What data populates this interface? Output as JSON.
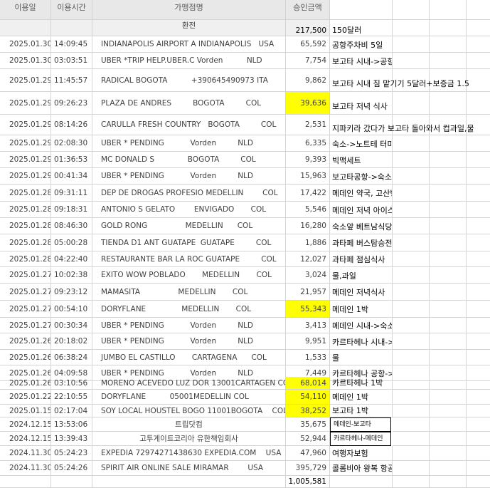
{
  "header": {
    "date": "이용일",
    "time": "이용시간",
    "merchant": "가맹점명",
    "amount": "승인금액"
  },
  "subheader": {
    "label": "환전",
    "amount": "217,500",
    "note": "150달러"
  },
  "rows": [
    {
      "date": "2025.01.30",
      "time": "14:09:45",
      "merchant": "INDIANAPOLIS AIRPORT A INDIANAPOLIS   USA",
      "amount": "65,592",
      "note": "공항주차비 5일"
    },
    {
      "date": "2025.01.30",
      "time": "03:03:51",
      "merchant": "UBER *TRIP HELP.UBER.C Vorden          NLD",
      "amount": "7,754",
      "note": "보고타 시내->공항 우버"
    },
    {
      "date": "2025.01.29",
      "time": "11:45:57",
      "merchant": "RADICAL BOGOTA          +390645490973 ITA",
      "amount": "9,862",
      "note": "보고타 시내 짐 맡기기 5달러+보증금 1.5"
    },
    {
      "date": "2025.01.29",
      "time": "09:26:23",
      "merchant": "PLAZA DE ANDRES         BOGOTA         COL",
      "amount": "39,636",
      "note": "보고타 저녁 식사"
    },
    {
      "date": "2025.01.29",
      "time": "08:14:26",
      "merchant": "CARULLA FRESH COUNTRY   BOGOTA         COL",
      "amount": "2,531",
      "note": "지파키라 갔다가 보고타 돌아와서 컵과일,물"
    },
    {
      "date": "2025.01.29",
      "time": "02:08:30",
      "merchant": "UBER * PENDING           Vorden         NLD",
      "amount": "6,335",
      "note": "숙소->노트테 터미널"
    },
    {
      "date": "2025.01.29",
      "time": "01:36:53",
      "merchant": "MC DONALD S              BOGOTA         COL",
      "amount": "9,393",
      "note": "빅맥세트"
    },
    {
      "date": "2025.01.29",
      "time": "00:41:34",
      "merchant": "UBER * PENDING           Vorden         NLD",
      "amount": "15,963",
      "note": "보고타공항->숙소 40분"
    },
    {
      "date": "2025.01.28",
      "time": "09:31:11",
      "merchant": "DEP DE DROGAS PROFESIO MEDELLIN        COL",
      "amount": "17,422",
      "note": "메데인 약국, 고산병약"
    },
    {
      "date": "2025.01.28",
      "time": "09:18:31",
      "merchant": "ANTONIO S GELATO        ENVIGADO       COL",
      "amount": "5,546",
      "note": "메데인 저녁 아이스크림"
    },
    {
      "date": "2025.01.28",
      "time": "08:46:30",
      "merchant": "GOLD RONG                MEDELLIN      COL",
      "amount": "16,280",
      "note": "숙소앞 베트남식당"
    },
    {
      "date": "2025.01.28",
      "time": "05:00:28",
      "merchant": "TIENDA D1 ANT GUATAPE  GUATAPE         COL",
      "amount": "1,886",
      "note": "과타페 버스탐승전 물,아이스크림"
    },
    {
      "date": "2025.01.28",
      "time": "04:22:40",
      "merchant": "RESTAURANTE BAR LA ROC GUATAPE         COL",
      "amount": "12,027",
      "note": "과타페 점심식사"
    },
    {
      "date": "2025.01.27",
      "time": "10:02:38",
      "merchant": "EXITO WOW POBLADO       MEDELLIN       COL",
      "amount": "3,024",
      "note": "물,과일"
    },
    {
      "date": "2025.01.27",
      "time": "09:23:12",
      "merchant": "MAMASITA                MEDELLIN       COL",
      "amount": "21,957",
      "note": "메데인 저녁식사"
    },
    {
      "date": "2025.01.27",
      "time": "00:54:10",
      "merchant": "DORYFLANE               MEDELLIN       COL",
      "amount": "55,343",
      "note": "메데인 1박"
    },
    {
      "date": "2025.01.27",
      "time": "00:30:34",
      "merchant": "UBER * PENDING           Vorden         NLD",
      "amount": "3,413",
      "note": "메데인 시내->숙소 우버"
    },
    {
      "date": "2025.01.26",
      "time": "20:18:02",
      "merchant": "UBER * PENDING           Vorden         NLD",
      "amount": "9,951",
      "note": "카르타헤나 시내->공항 우버"
    },
    {
      "date": "2025.01.26",
      "time": "06:38:24",
      "merchant": "JUMBO EL CASTILLO       CARTAGENA      COL",
      "amount": "1,533",
      "note": "물"
    },
    {
      "date": "2025.01.26",
      "time": "04:09:58",
      "merchant": "UBER * PENDING           Vorden         NLD",
      "amount": "7,449",
      "note": "카르타헤나 공항->시내 우버"
    },
    {
      "date": "2025.01.26",
      "time": "03:10:56",
      "merchant": "MORENO ACEVEDO LUZ DOR 13001CARTAGEN COL",
      "amount": "68,014",
      "note": "카르타헤나 1박"
    },
    {
      "date": "2025.01.22",
      "time": "22:10:55",
      "merchant": "DORYFLANE          05001MEDELLIN COL",
      "amount": "54,110",
      "note": "메데인 1박"
    },
    {
      "date": "2025.01.15",
      "time": "02:17:04",
      "merchant": "SOY LOCAL HOUSTEL BOGO 11001BOGOTA    COL",
      "amount": "38,252",
      "note": "보고타 1박"
    },
    {
      "date": "2024.12.15",
      "time": "13:53:06",
      "merchant": "트립닷컴",
      "amount": "35,675",
      "note": "메데인-보고타"
    },
    {
      "date": "2024.12.15",
      "time": "13:39:43",
      "merchant": "고투게이트코리아 유한책임회사",
      "amount": "52,944",
      "note": "카르타헤나-메데인"
    },
    {
      "date": "2024.11.30",
      "time": "05:24:23",
      "merchant": "EXPEDIA 72974271438630 EXPEDIA.COM    USA",
      "amount": "47,960",
      "note": "여행자보험"
    },
    {
      "date": "2024.11.30",
      "time": "05:24:26",
      "merchant": "SPIRIT AIR ONLINE SALE MIRAMAR        USA",
      "amount": "395,729",
      "note": "콜롬비아 왕복 항공권"
    }
  ],
  "total": {
    "amount": "1,005,581"
  },
  "colors": {
    "highlight": "#ffff00",
    "header_bg": "#e8e8e8",
    "grid": "#d4d4d4"
  }
}
